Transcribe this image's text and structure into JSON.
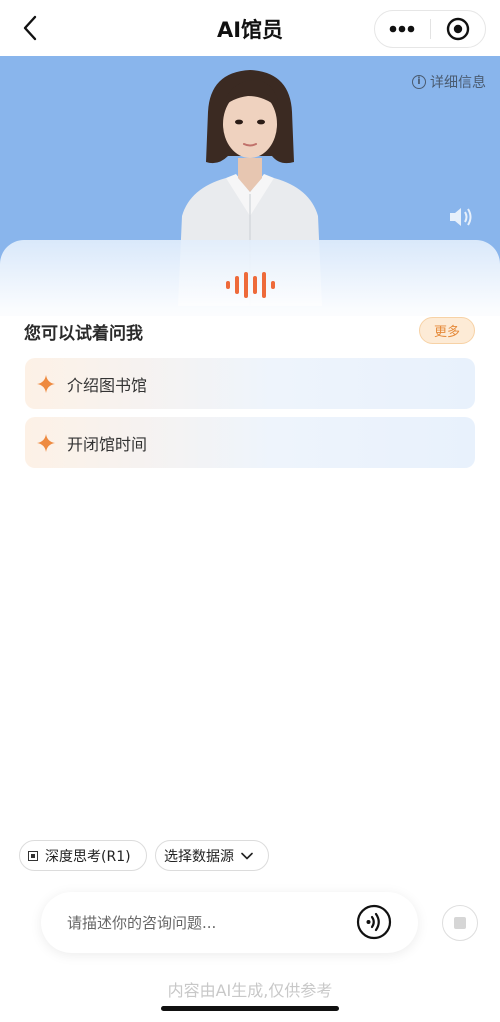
{
  "header": {
    "title": "AI馆员",
    "back_icon": "chevron-left-icon",
    "more_icon": "more-dots-icon",
    "close_icon": "target-close-icon"
  },
  "hero": {
    "detail_label": "详细信息",
    "background": "#89b5ec"
  },
  "suggestions": {
    "title": "您可以试着问我",
    "more_label": "更多",
    "items": [
      {
        "label": "介绍图书馆"
      },
      {
        "label": "开闭馆时间"
      }
    ]
  },
  "options": {
    "deep_think_label": "深度思考(R1)",
    "datasource_label": "选择数据源"
  },
  "input": {
    "placeholder": "请描述你的咨询问题..."
  },
  "footer": {
    "disclaimer": "内容由AI生成,仅供参考"
  },
  "colors": {
    "accent": "#e58a3a",
    "more_bg": "#fdebd6"
  }
}
